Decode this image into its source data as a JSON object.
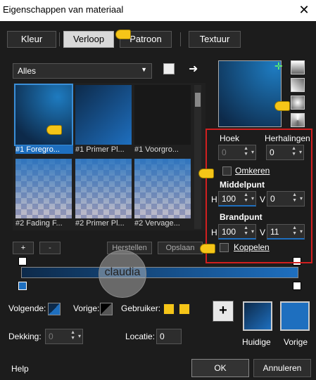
{
  "window": {
    "title": "Eigenschappen van materiaal",
    "close": "✕"
  },
  "tabs": [
    "Kleur",
    "Verloop",
    "Patroon",
    "Textuur"
  ],
  "category": {
    "selected": "Alles"
  },
  "thumbnails": [
    {
      "label": "#1 Foregro...",
      "type": "gradient"
    },
    {
      "label": "#1 Primer Pl...",
      "type": "gradient"
    },
    {
      "label": "#1 Voorgro...",
      "type": "dark"
    },
    {
      "label": "#2 Fading F...",
      "type": "checker"
    },
    {
      "label": "#2 Primer Pl...",
      "type": "checker"
    },
    {
      "label": "#2 Vervage...",
      "type": "checker"
    }
  ],
  "list_buttons": {
    "add": "+",
    "remove": "-",
    "restore": "Herstellen",
    "save": "Opslaan"
  },
  "params": {
    "hoek_label": "Hoek",
    "hoek_value": "0",
    "herhalingen_label": "Herhalingen",
    "herhalingen_value": "0",
    "omkeren_label": "Omkeren",
    "middelpunt_label": "Middelpunt",
    "mid_h_label": "H",
    "mid_h_value": "100",
    "mid_v_label": "V",
    "mid_v_value": "0",
    "brandpunt_label": "Brandpunt",
    "brand_h_label": "H",
    "brand_h_value": "100",
    "brand_v_label": "V",
    "brand_v_value": "11",
    "koppelen_label": "Koppelen"
  },
  "watermark": "claudia",
  "bottom": {
    "volgende_label": "Volgende:",
    "vorige_label": "Vorige:",
    "gebruiker_label": "Gebruiker:",
    "dekking_label": "Dekking:",
    "dekking_value": "0",
    "locatie_label": "Locatie:",
    "locatie_value": "0",
    "huidige_label": "Huidige",
    "vorige_swatch_label": "Vorige",
    "add": "+"
  },
  "footer": {
    "help": "Help",
    "ok": "OK",
    "cancel": "Annuleren"
  },
  "colors": {
    "accent": "#1e6fbf",
    "highlight_box": "#d11f1f",
    "pointer": "#f5c518"
  }
}
